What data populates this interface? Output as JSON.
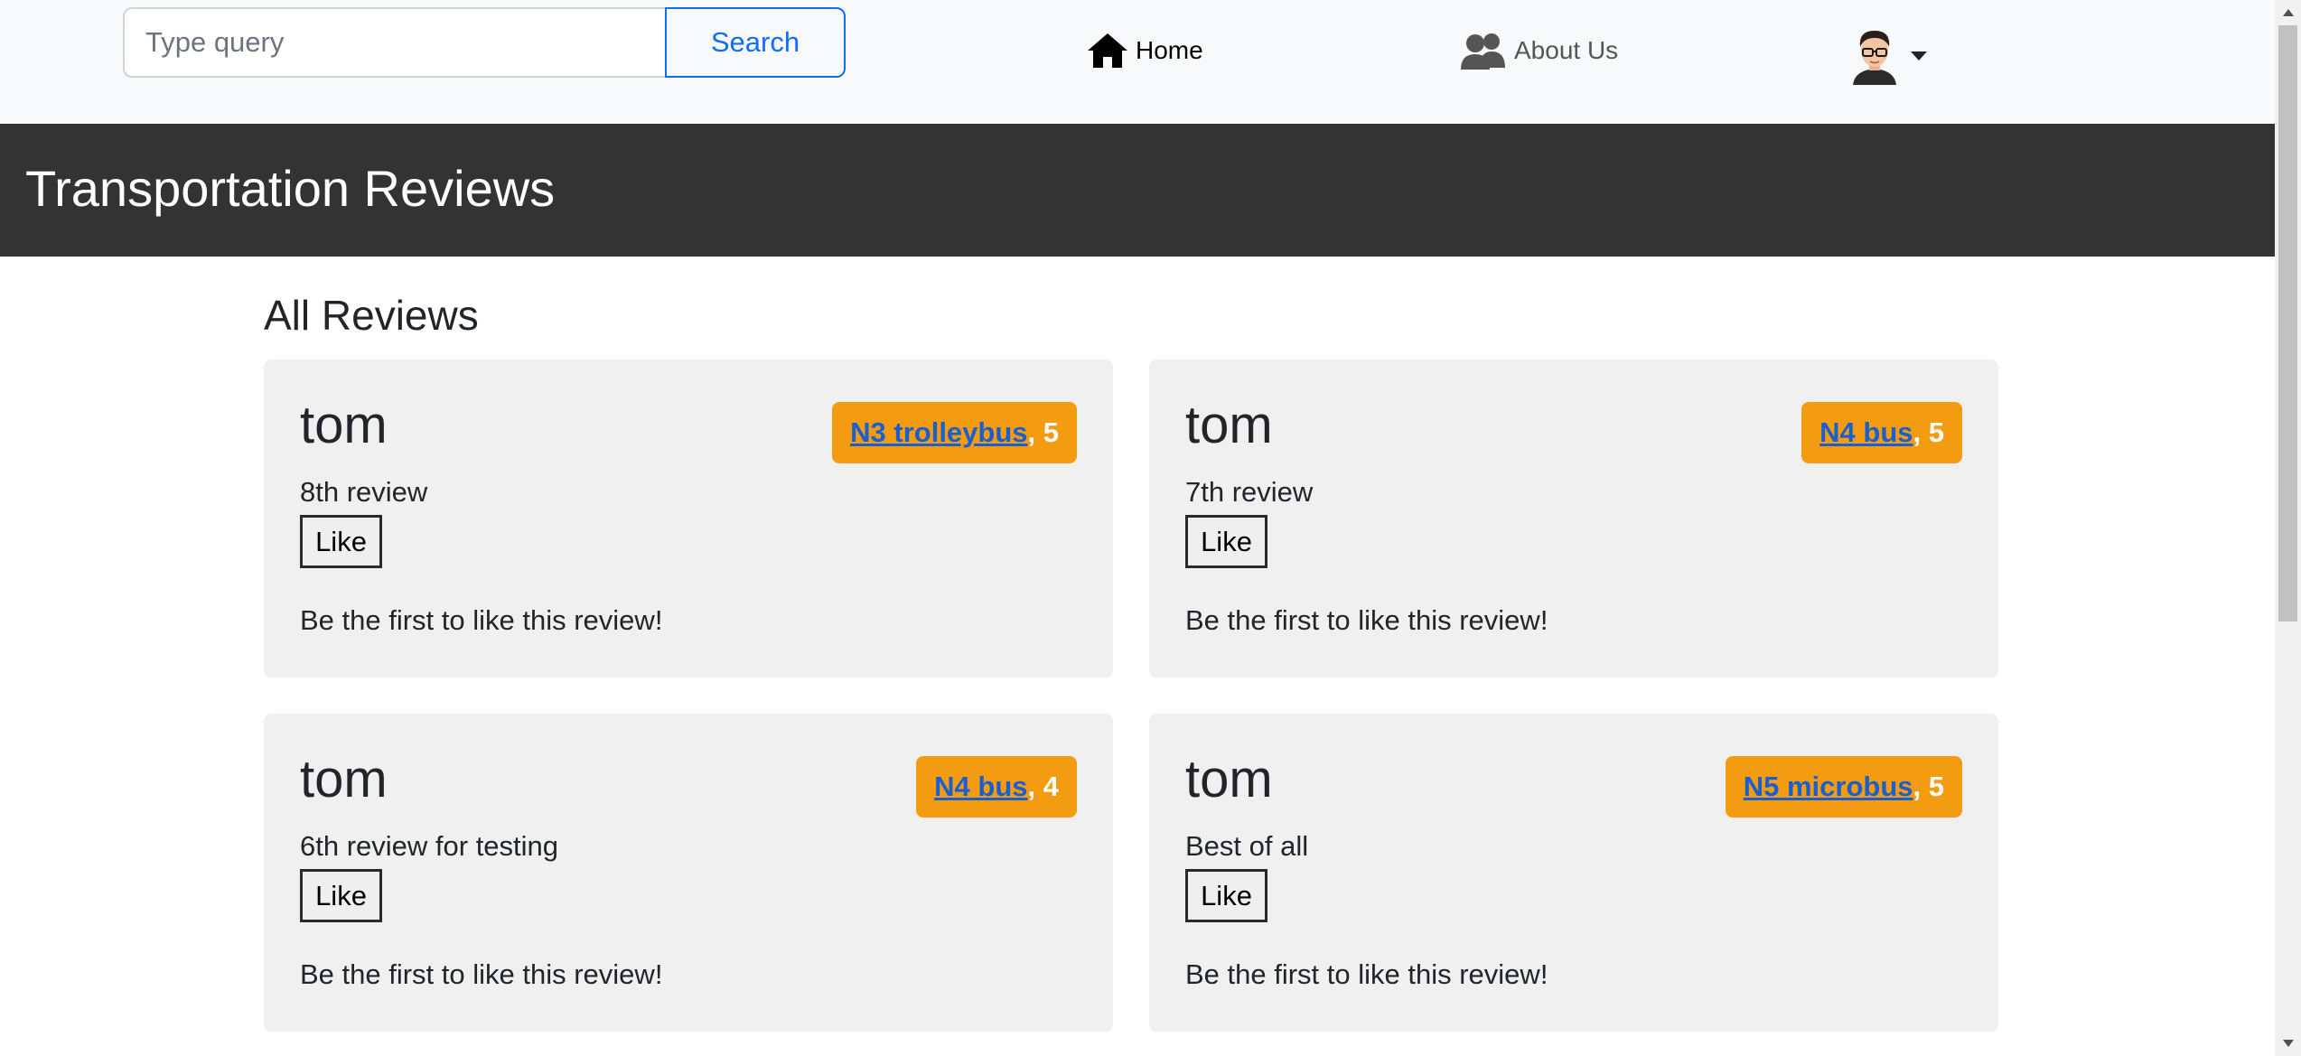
{
  "search": {
    "placeholder": "Type query",
    "value": "",
    "button_label": "Search"
  },
  "nav": {
    "home": {
      "label": "Home",
      "icon": "home-icon"
    },
    "about": {
      "label": "About Us",
      "icon": "users-icon"
    },
    "user_menu": {
      "icon": "avatar"
    }
  },
  "header": {
    "title": "Transportation Reviews"
  },
  "main": {
    "section_title": "All Reviews",
    "reviews": [
      {
        "author": "tom",
        "vehicle": "N3 trolleybus",
        "rating_text": ", 5",
        "text": "8th review",
        "like_label": "Like",
        "likes_text": "Be the first to like this review!"
      },
      {
        "author": "tom",
        "vehicle": "N4 bus",
        "rating_text": ", 5",
        "text": "7th review",
        "like_label": "Like",
        "likes_text": "Be the first to like this review!"
      },
      {
        "author": "tom",
        "vehicle": "N4 bus",
        "rating_text": ", 4",
        "text": "6th review for testing",
        "like_label": "Like",
        "likes_text": "Be the first to like this review!"
      },
      {
        "author": "tom",
        "vehicle": "N5 microbus",
        "rating_text": ", 5",
        "text": "Best of all",
        "like_label": "Like",
        "likes_text": "Be the first to like this review!"
      }
    ]
  },
  "colors": {
    "navbar_bg": "#f8f9fa",
    "header_bg": "#333333",
    "accent_blue": "#0d6efd",
    "badge_orange": "#f39c12",
    "card_bg": "#f0f0f0"
  }
}
